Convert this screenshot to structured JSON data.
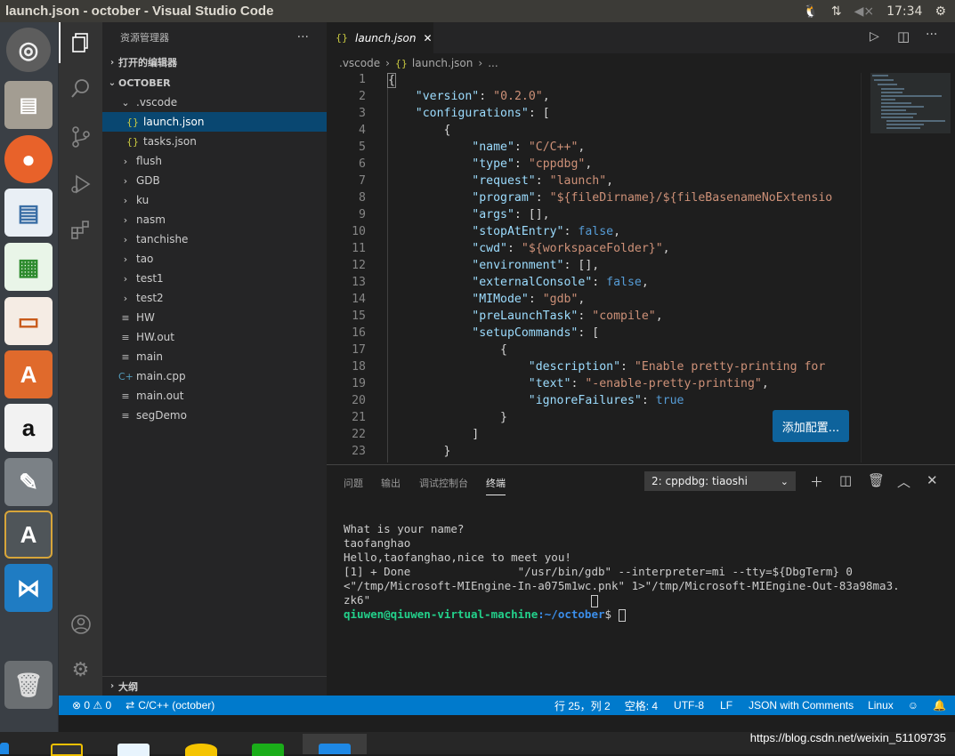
{
  "window": {
    "title": "launch.json - october - Visual Studio Code",
    "time": "17:34"
  },
  "sidebar": {
    "header": "资源管理器",
    "open_editors": "打开的编辑器",
    "folder": "OCTOBER",
    "items": [
      {
        "label": ".vscode",
        "type": "folder-open",
        "indent": 1
      },
      {
        "label": "launch.json",
        "type": "json",
        "indent": 2,
        "selected": true
      },
      {
        "label": "tasks.json",
        "type": "json",
        "indent": 2
      },
      {
        "label": "flush",
        "type": "folder",
        "indent": 1
      },
      {
        "label": "GDB",
        "type": "folder",
        "indent": 1
      },
      {
        "label": "ku",
        "type": "folder",
        "indent": 1
      },
      {
        "label": "nasm",
        "type": "folder",
        "indent": 1
      },
      {
        "label": "tanchishe",
        "type": "folder",
        "indent": 1
      },
      {
        "label": "tao",
        "type": "folder",
        "indent": 1
      },
      {
        "label": "test1",
        "type": "folder",
        "indent": 1
      },
      {
        "label": "test2",
        "type": "folder",
        "indent": 1
      },
      {
        "label": "HW",
        "type": "file",
        "indent": 1
      },
      {
        "label": "HW.out",
        "type": "file",
        "indent": 1
      },
      {
        "label": "main",
        "type": "file",
        "indent": 1
      },
      {
        "label": "main.cpp",
        "type": "cpp",
        "indent": 1
      },
      {
        "label": "main.out",
        "type": "file",
        "indent": 1
      },
      {
        "label": "segDemo",
        "type": "file",
        "indent": 1
      }
    ],
    "outline": "大纲"
  },
  "editor": {
    "tab": "launch.json",
    "breadcrumb": [
      ".vscode",
      "launch.json",
      "..."
    ],
    "lines": [
      "1",
      "2",
      "3",
      "4",
      "5",
      "6",
      "7",
      "8",
      "9",
      "10",
      "11",
      "12",
      "13",
      "14",
      "15",
      "16",
      "17",
      "18",
      "19",
      "20",
      "21",
      "22",
      "23"
    ],
    "add_config": "添加配置..."
  },
  "panel": {
    "tabs": [
      "问题",
      "输出",
      "调试控制台",
      "终端"
    ],
    "terminal_select": "2: cppdbg: tiaoshi",
    "terminal_lines": [
      "What is your name?",
      "taofanghao",
      "Hello,taofanghao,nice to meet you!",
      "[1] + Done                \"/usr/bin/gdb\" --interpreter=mi --tty=${DbgTerm} 0",
      "<\"/tmp/Microsoft-MIEngine-In-a075m1wc.pnk\" 1>\"/tmp/Microsoft-MIEngine-Out-83a98ma3.",
      "zk6\""
    ],
    "prompt_user": "qiuwen@qiuwen-virtual-machine",
    "prompt_path": ":~/october",
    "prompt_end": "$ "
  },
  "status": {
    "errors": "⊗ 0 ⚠ 0",
    "config": "C/C++ (october)",
    "position": "行 25，列 2",
    "spaces": "空格: 4",
    "encoding": "UTF-8",
    "eol": "LF",
    "language": "JSON with Comments",
    "platform": "Linux"
  },
  "watermark": "https://blog.csdn.net/weixin_51109735",
  "colors": {
    "accent": "#007acc",
    "selection": "#094771"
  }
}
